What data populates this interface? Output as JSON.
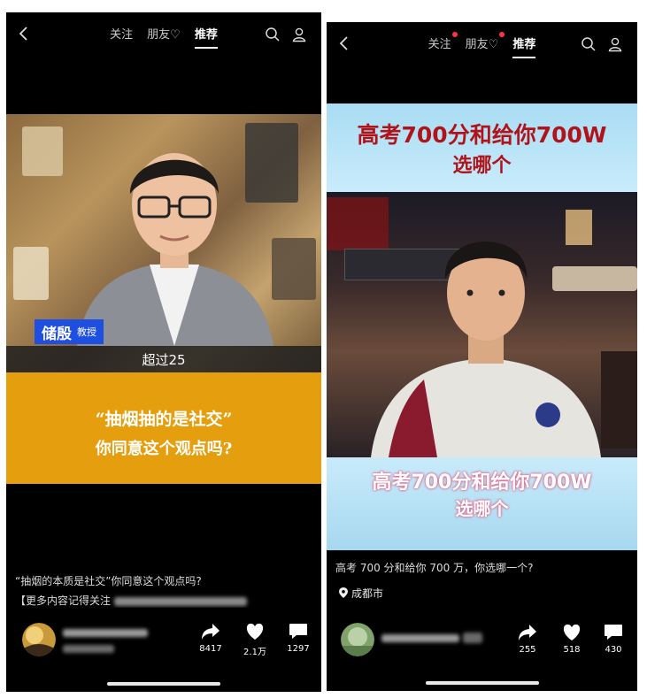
{
  "left_screen": {
    "tabs": [
      "关注",
      "朋友♡",
      "推荐"
    ],
    "active_tab": "推荐",
    "video": {
      "name_tag": "储殷",
      "name_title": "教授",
      "subtitle": "超过25",
      "quote_line1": "“抽烟抽的是社交”",
      "quote_line2": "你同意这个观点吗?"
    },
    "caption_line1": "“抽烟的本质是社交”你同意这个观点吗?",
    "caption_line2": "【更多内容记得关注",
    "actions": {
      "shares": "8417",
      "likes": "2.1万",
      "comments": "1297"
    }
  },
  "right_screen": {
    "tabs": [
      "关注",
      "朋友♡",
      "推荐"
    ],
    "active_tab": "推荐",
    "video": {
      "headline_top_line1": "高考700分和给你700W",
      "headline_top_line2": "选哪个",
      "headline_bottom_line1": "高考700分和给你700W",
      "headline_bottom_line2": "选哪个"
    },
    "caption": "高考 700 分和给你 700 万，你选哪一个?",
    "location": "成都市",
    "actions": {
      "shares": "255",
      "likes": "518",
      "comments": "430"
    }
  },
  "colors": {
    "background": "#000000",
    "quote_band": "#e59e0d",
    "name_tag": "#1e4fe0",
    "headline_red": "#b0141a",
    "notification_dot": "#ff3344"
  },
  "icons": [
    "back-icon",
    "search-icon",
    "user-icon",
    "share-icon",
    "heart-icon",
    "comment-icon",
    "location-pin-icon"
  ]
}
